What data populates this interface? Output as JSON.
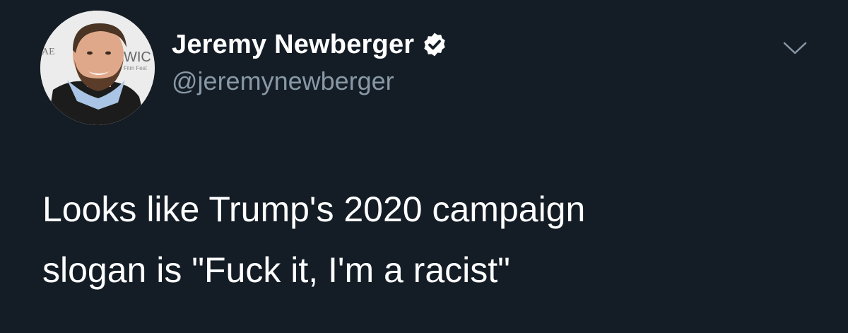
{
  "user": {
    "display_name": "Jeremy Newberger",
    "handle": "@jeremynewberger",
    "verified": true
  },
  "tweet": {
    "text": "Looks like Trump's 2020 campaign\nslogan is \"Fuck it, I'm a racist\""
  },
  "avatar_backdrop": {
    "left_text": "AE",
    "right_text": "WIC",
    "right_subtext": "Film Fest"
  },
  "icons": {
    "verified": "verified-badge-icon",
    "menu": "chevron-down-icon"
  },
  "colors": {
    "background": "#141d26",
    "name": "#ffffff",
    "handle": "#8899a6",
    "text": "#ffffff",
    "caret": "#8899a6"
  }
}
